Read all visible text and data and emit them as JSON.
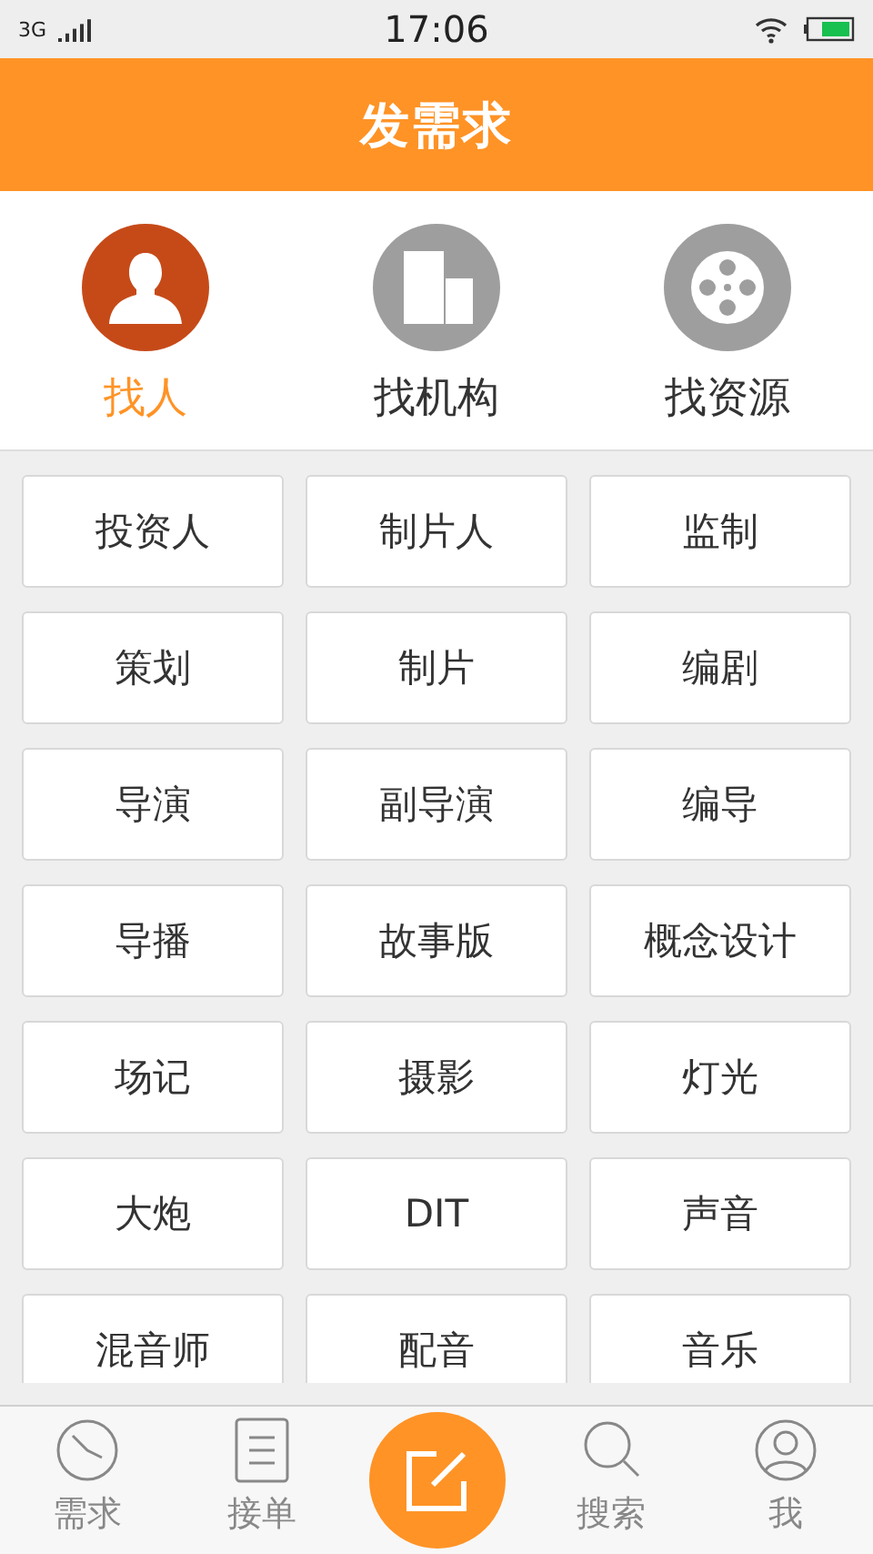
{
  "status_bar": {
    "network": "3G",
    "time": "17:06"
  },
  "header": {
    "title": "发需求"
  },
  "categories": [
    {
      "label": "找人",
      "selected": true
    },
    {
      "label": "找机构",
      "selected": false
    },
    {
      "label": "找资源",
      "selected": false
    }
  ],
  "roles": [
    "投资人",
    "制片人",
    "监制",
    "策划",
    "制片",
    "编剧",
    "导演",
    "副导演",
    "编导",
    "导播",
    "故事版",
    "概念设计",
    "场记",
    "摄影",
    "灯光",
    "大炮",
    "DIT",
    "声音",
    "混音师",
    "配音",
    "音乐"
  ],
  "nav": [
    {
      "kind": "tab",
      "label": "需求"
    },
    {
      "kind": "tab",
      "label": "接单"
    },
    {
      "kind": "action"
    },
    {
      "kind": "tab",
      "label": "搜索"
    },
    {
      "kind": "tab",
      "label": "我"
    }
  ]
}
